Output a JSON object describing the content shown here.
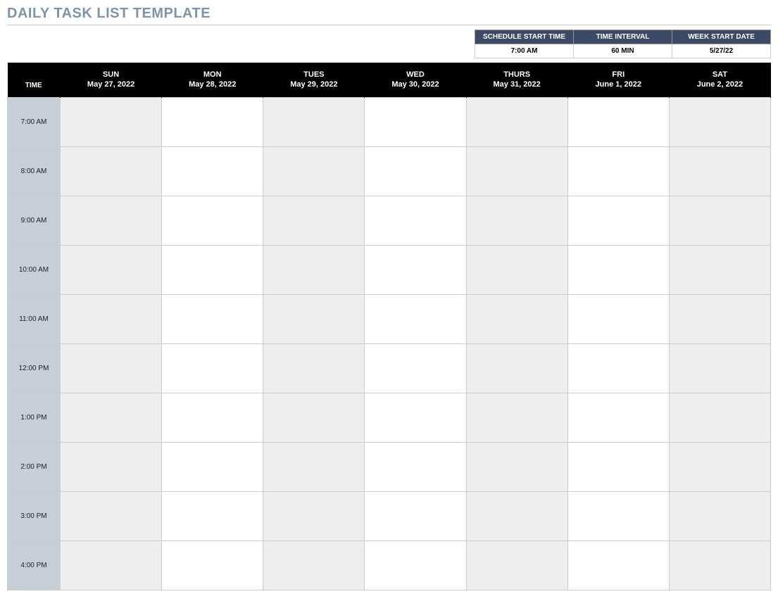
{
  "title": "DAILY TASK LIST TEMPLATE",
  "settings": {
    "headers": {
      "start_time": "SCHEDULE START TIME",
      "interval": "TIME INTERVAL",
      "week_start": "WEEK START DATE"
    },
    "values": {
      "start_time": "7:00 AM",
      "interval": "60 MIN",
      "week_start": "5/27/22"
    }
  },
  "schedule": {
    "time_header": "TIME",
    "days": [
      {
        "name": "SUN",
        "date": "May 27, 2022"
      },
      {
        "name": "MON",
        "date": "May 28, 2022"
      },
      {
        "name": "TUES",
        "date": "May 29, 2022"
      },
      {
        "name": "WED",
        "date": "May 30, 2022"
      },
      {
        "name": "THURS",
        "date": "May 31, 2022"
      },
      {
        "name": "FRI",
        "date": "June 1, 2022"
      },
      {
        "name": "SAT",
        "date": "June 2, 2022"
      }
    ],
    "times": [
      "7:00 AM",
      "8:00 AM",
      "9:00 AM",
      "10:00 AM",
      "11:00 AM",
      "12:00 PM",
      "1:00 PM",
      "2:00 PM",
      "3:00 PM",
      "4:00 PM"
    ],
    "shaded_day_indices": [
      0,
      2,
      4,
      6
    ]
  }
}
